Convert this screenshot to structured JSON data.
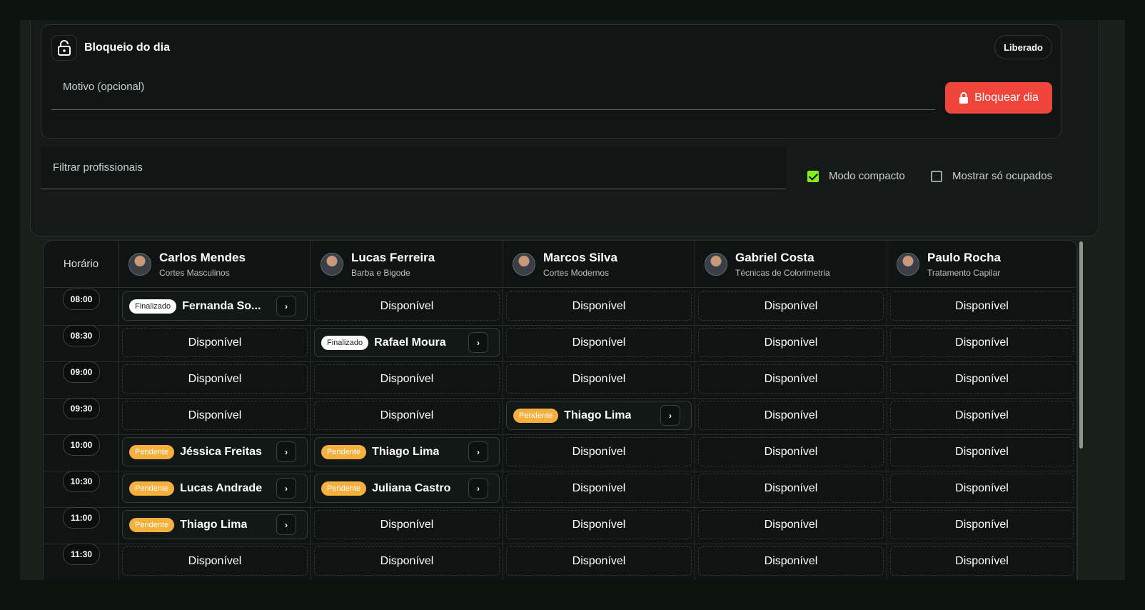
{
  "block_day": {
    "title": "Bloqueio do dia",
    "status": "Liberado",
    "reason_label": "Motivo (opcional)",
    "block_button": "Bloquear dia"
  },
  "filters": {
    "search_label": "Filtrar profissionais",
    "compact_label": "Modo compacto",
    "compact_checked": true,
    "busy_only_label": "Mostrar só ocupados",
    "busy_only_checked": false
  },
  "schedule": {
    "time_header": "Horário",
    "empty_label": "Disponível",
    "professionals": [
      {
        "name": "Carlos Mendes",
        "specialty": "Cortes Masculinos"
      },
      {
        "name": "Lucas Ferreira",
        "specialty": "Barba e Bigode"
      },
      {
        "name": "Marcos Silva",
        "specialty": "Cortes Modernos"
      },
      {
        "name": "Gabriel Costa",
        "specialty": "Técnicas de Colorimetria"
      },
      {
        "name": "Paulo Rocha",
        "specialty": "Tratamento Capilar"
      }
    ],
    "rows": [
      {
        "time": "08:00",
        "slots": [
          {
            "status": "Finalizado",
            "client": "Fernanda So..."
          },
          null,
          null,
          null,
          null
        ]
      },
      {
        "time": "08:30",
        "slots": [
          null,
          {
            "status": "Finalizado",
            "client": "Rafael Moura"
          },
          null,
          null,
          null
        ]
      },
      {
        "time": "09:00",
        "slots": [
          null,
          null,
          null,
          null,
          null
        ]
      },
      {
        "time": "09:30",
        "slots": [
          null,
          null,
          {
            "status": "Pendente",
            "client": "Thiago Lima"
          },
          null,
          null
        ]
      },
      {
        "time": "10:00",
        "slots": [
          {
            "status": "Pendente",
            "client": "Jéssica Freitas"
          },
          {
            "status": "Pendente",
            "client": "Thiago Lima"
          },
          null,
          null,
          null
        ]
      },
      {
        "time": "10:30",
        "slots": [
          {
            "status": "Pendente",
            "client": "Lucas Andrade"
          },
          {
            "status": "Pendente",
            "client": "Juliana Castro"
          },
          null,
          null,
          null
        ]
      },
      {
        "time": "11:00",
        "slots": [
          {
            "status": "Pendente",
            "client": "Thiago Lima"
          },
          null,
          null,
          null,
          null
        ]
      },
      {
        "time": "11:30",
        "slots": [
          null,
          null,
          null,
          null,
          null
        ]
      }
    ]
  },
  "colors": {
    "accent_danger": "#f0453a",
    "checkbox_on": "#86f01a",
    "pending": "#f5b03e",
    "finished": "#ffffff"
  }
}
